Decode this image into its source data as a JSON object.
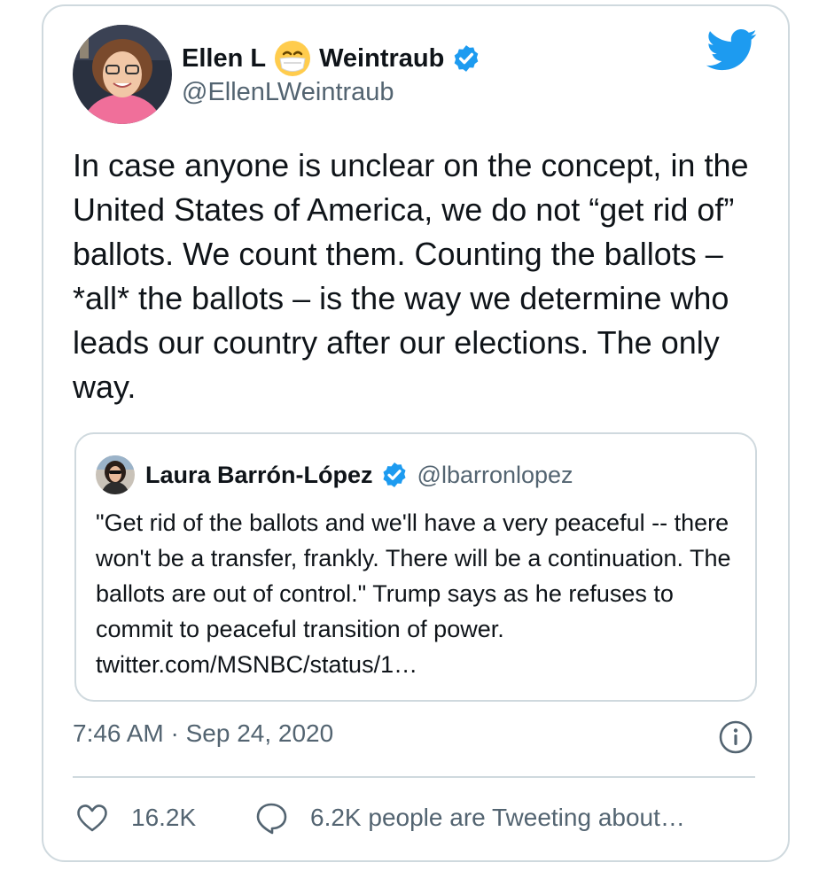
{
  "author": {
    "name_first": "Ellen L",
    "name_last": "Weintraub",
    "name_emoji_icon": "face-with-medical-mask-icon",
    "handle": "@EllenLWeintraub",
    "verified": true
  },
  "tweet": {
    "text": "In case anyone is unclear on the concept, in the United States of America, we do not “get rid of” ballots. We count them. Counting the ballots – *all* the ballots – is the way we determine who leads our country after our elections. The only way.",
    "timestamp": "7:46 AM · Sep 24, 2020"
  },
  "quoted": {
    "name": "Laura Barrón-López",
    "handle": "@lbarronlopez",
    "verified": true,
    "text": "\"Get rid of the ballots and we'll have a very peaceful -- there won't be a transfer, frankly. There will be a continuation. The ballots are out of control.\" Trump says as he refuses to commit to peaceful transition of power. twitter.com/MSNBC/status/1…"
  },
  "metrics": {
    "likes": "16.2K",
    "tweeting_text": "6.2K people are Tweeting about…"
  },
  "colors": {
    "twitter_blue": "#1d9bf0",
    "secondary_text": "#536471",
    "border": "#cfd9de"
  },
  "icons": [
    "twitter-logo-icon",
    "verified-badge-icon",
    "info-icon",
    "heart-icon",
    "reply-bubble-icon"
  ]
}
